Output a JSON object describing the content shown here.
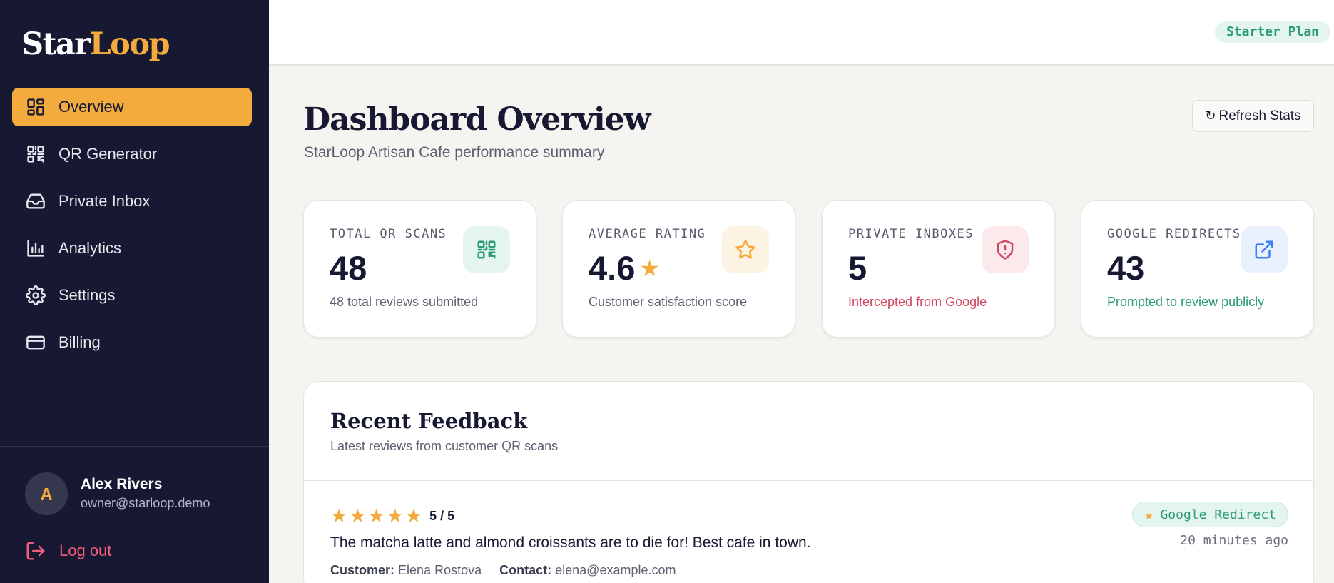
{
  "brand": {
    "part1": "Star",
    "part2": "Loop"
  },
  "sidebar": {
    "items": [
      {
        "label": "Overview",
        "icon": "grid-icon",
        "active": true
      },
      {
        "label": "QR Generator",
        "icon": "qr-icon"
      },
      {
        "label": "Private Inbox",
        "icon": "inbox-icon"
      },
      {
        "label": "Analytics",
        "icon": "bar-chart-icon"
      },
      {
        "label": "Settings",
        "icon": "gear-icon"
      },
      {
        "label": "Billing",
        "icon": "credit-card-icon"
      }
    ],
    "user": {
      "initial": "A",
      "name": "Alex Rivers",
      "email": "owner@starloop.demo"
    },
    "logout_label": "Log out"
  },
  "topbar": {
    "plan": "Starter Plan"
  },
  "header": {
    "title": "Dashboard Overview",
    "subtitle": "StarLoop Artisan Cafe performance summary",
    "refresh_glyph": "↻",
    "refresh_label": "Refresh Stats"
  },
  "stats": [
    {
      "label": "TOTAL QR SCANS",
      "value": "48",
      "desc": "48 total reviews submitted",
      "icon": "qr-icon",
      "accent": "#2a9a78"
    },
    {
      "label": "AVERAGE RATING",
      "value": "4.6",
      "value_glyph": "★",
      "desc": "Customer satisfaction score",
      "icon": "star-icon",
      "accent": "#f2ab3c"
    },
    {
      "label": "PRIVATE INBOXES",
      "value": "5",
      "desc": "Intercepted from Google",
      "icon": "shield-alert-icon",
      "accent": "#d2455f"
    },
    {
      "label": "GOOGLE REDIRECTS",
      "value": "43",
      "desc": "Prompted to review publicly",
      "icon": "external-link-icon",
      "accent": "#2a9a78"
    }
  ],
  "feedback": {
    "title": "Recent Feedback",
    "subtitle": "Latest reviews from customer QR scans",
    "reviews": [
      {
        "star_glyph": "★",
        "rating": 5,
        "score": "5 / 5",
        "text": "The matcha latte and almond croissants are to die for! Best cafe in town.",
        "customer_label": "Customer:",
        "customer": "Elena Rostova",
        "contact_label": "Contact:",
        "contact": "elena@example.com",
        "badge_glyph": "★",
        "badge": "Google Redirect",
        "time": "20 minutes ago"
      }
    ]
  },
  "colors": {
    "sidebar_bg": "#171933",
    "accent": "#f2ab3c",
    "success": "#2a9a78",
    "danger": "#d2455f",
    "link_blue": "#3b82f6"
  }
}
